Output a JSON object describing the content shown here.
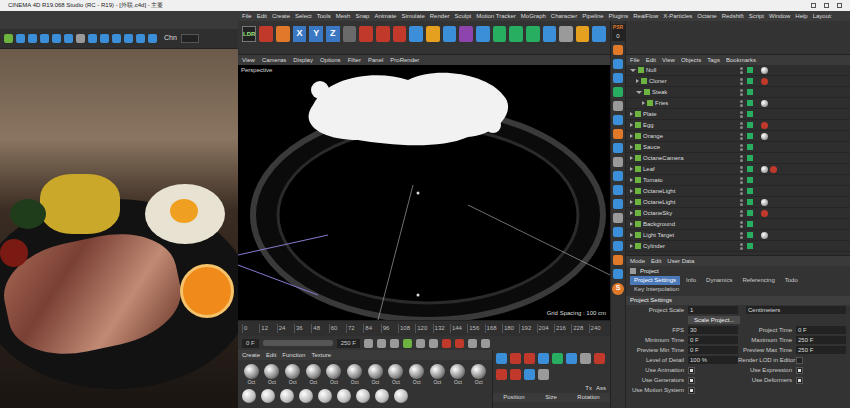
{
  "window": {
    "title": "CINEMA 4D R19.068 Studio (RC - R19) - [外联.c4d] - 主要"
  },
  "viewer": {
    "channel": "Chn"
  },
  "menu": [
    "File",
    "Edit",
    "Create",
    "Select",
    "Tools",
    "Mesh",
    "Snap",
    "Animate",
    "Simulate",
    "Render",
    "Sculpt",
    "Motion Tracker",
    "MoGraph",
    "Character",
    "Pipeline",
    "Plugins",
    "RealFlow",
    "X-Particles",
    "Octane",
    "Redshift",
    "Script",
    "Window",
    "Help",
    "Layout:"
  ],
  "toolbar": {
    "axes": [
      "X",
      "Y",
      "Z"
    ],
    "badge": "LDR"
  },
  "viewport": {
    "menu": [
      "View",
      "Cameras",
      "Display",
      "Options",
      "Filter",
      "Panel",
      "ProRender"
    ],
    "camera": "Perspective",
    "grid": "Grid Spacing : 100 cm"
  },
  "timeline": {
    "ticks": [
      "0",
      "12",
      "24",
      "36",
      "48",
      "60",
      "72",
      "84",
      "96",
      "108",
      "120",
      "132",
      "144",
      "156",
      "168",
      "180",
      "192",
      "204",
      "216",
      "228",
      "240"
    ],
    "start": "0 F",
    "end": "250 F"
  },
  "materials": {
    "menu": [
      "Create",
      "Edit",
      "Function",
      "Texture"
    ],
    "items": [
      "Oct",
      "Oct",
      "Oct",
      "Oct",
      "Oct",
      "Oct",
      "Oct",
      "Oct",
      "Oct",
      "Oct",
      "Oct",
      "Oct"
    ]
  },
  "coordinates": {
    "headers": [
      "Position",
      "Size",
      "Rotation"
    ],
    "buttons": [
      "Tx",
      "Ass"
    ]
  },
  "side_strip": {
    "psr": "PSR",
    "psr_value": "0",
    "s": "S"
  },
  "objects": {
    "menu": [
      "File",
      "Edit",
      "View",
      "Objects",
      "Tags",
      "Bookmarks"
    ],
    "items": [
      {
        "name": "Null",
        "depth": 0,
        "expanded": true
      },
      {
        "name": "Cloner",
        "depth": 1,
        "expanded": false
      },
      {
        "name": "Steak",
        "depth": 1,
        "expanded": true
      },
      {
        "name": "Fries",
        "depth": 2,
        "expanded": false
      },
      {
        "name": "Plate",
        "depth": 0,
        "expanded": false
      },
      {
        "name": "Egg",
        "depth": 0,
        "expanded": false
      },
      {
        "name": "Orange",
        "depth": 0,
        "expanded": false
      },
      {
        "name": "Sauce",
        "depth": 0,
        "expanded": false
      },
      {
        "name": "OctaneCamera",
        "depth": 0,
        "expanded": false
      },
      {
        "name": "Leaf",
        "depth": 0,
        "expanded": false
      },
      {
        "name": "Tomato",
        "depth": 0,
        "expanded": false
      },
      {
        "name": "OctaneLight",
        "depth": 0,
        "expanded": false
      },
      {
        "name": "OctaneLight",
        "depth": 0,
        "expanded": false
      },
      {
        "name": "OctaneSky",
        "depth": 0,
        "expanded": false
      },
      {
        "name": "Background",
        "depth": 0,
        "expanded": false
      },
      {
        "name": "Light Target",
        "depth": 0,
        "expanded": false
      },
      {
        "name": "Cylinder",
        "depth": 0,
        "expanded": false
      }
    ]
  },
  "attributes": {
    "menu": [
      "Mode",
      "Edit",
      "User Data"
    ],
    "title": "Project",
    "tabs": [
      {
        "label": "Project Settings",
        "selected": true
      },
      {
        "label": "Info",
        "selected": false
      },
      {
        "label": "Dynamics",
        "selected": false
      },
      {
        "label": "Referencing",
        "selected": false
      },
      {
        "label": "Todo",
        "selected": false
      },
      {
        "label": "Key Interpolation",
        "selected": false
      }
    ],
    "section": "Project Settings",
    "rows": [
      [
        {
          "kind": "field",
          "label": "Project Scale",
          "value": "1"
        },
        {
          "kind": "field",
          "label": "",
          "value": "Centimeters"
        }
      ],
      [
        {
          "kind": "button",
          "label": "Scale Project..."
        }
      ],
      [
        {
          "kind": "field",
          "label": "FPS",
          "value": "30"
        },
        {
          "kind": "field",
          "label": "Project Time",
          "value": "0 F"
        }
      ],
      [
        {
          "kind": "field",
          "label": "Minimum Time",
          "value": "0 F"
        },
        {
          "kind": "field",
          "label": "Maximum Time",
          "value": "250 F"
        }
      ],
      [
        {
          "kind": "field",
          "label": "Preview Min Time",
          "value": "0 F"
        },
        {
          "kind": "field",
          "label": "Preview Max Time",
          "value": "250 F"
        }
      ],
      [
        {
          "kind": "field",
          "label": "Level of Detail",
          "value": "100 %"
        },
        {
          "kind": "check",
          "label": "Render LOD in Editor",
          "checked": false
        }
      ],
      [
        {
          "kind": "check",
          "label": "Use Animation",
          "checked": true
        },
        {
          "kind": "check",
          "label": "Use Expression",
          "checked": true
        }
      ],
      [
        {
          "kind": "check",
          "label": "Use Generators",
          "checked": true
        },
        {
          "kind": "check",
          "label": "Use Deformers",
          "checked": true
        }
      ],
      [
        {
          "kind": "check",
          "label": "Use Motion System",
          "checked": true
        }
      ]
    ]
  }
}
